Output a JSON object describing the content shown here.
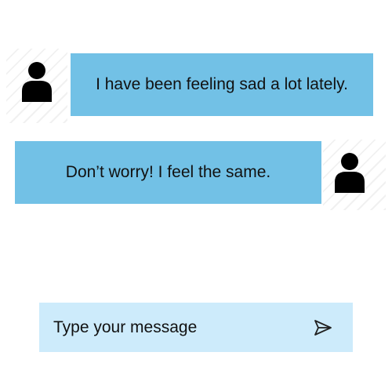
{
  "messages": [
    {
      "sender": "other",
      "text": "I have been feeling sad a lot lately.",
      "avatar_icon": "user-icon"
    },
    {
      "sender": "self",
      "text": "Don’t worry! I feel the same.",
      "avatar_icon": "user-icon"
    }
  ],
  "composer": {
    "placeholder": "Type your message",
    "send_icon": "send-icon"
  },
  "colors": {
    "bubble": "#72c1e6",
    "composer_bg": "#cdebfb",
    "avatar": "#000000",
    "background": "#ffffff"
  }
}
